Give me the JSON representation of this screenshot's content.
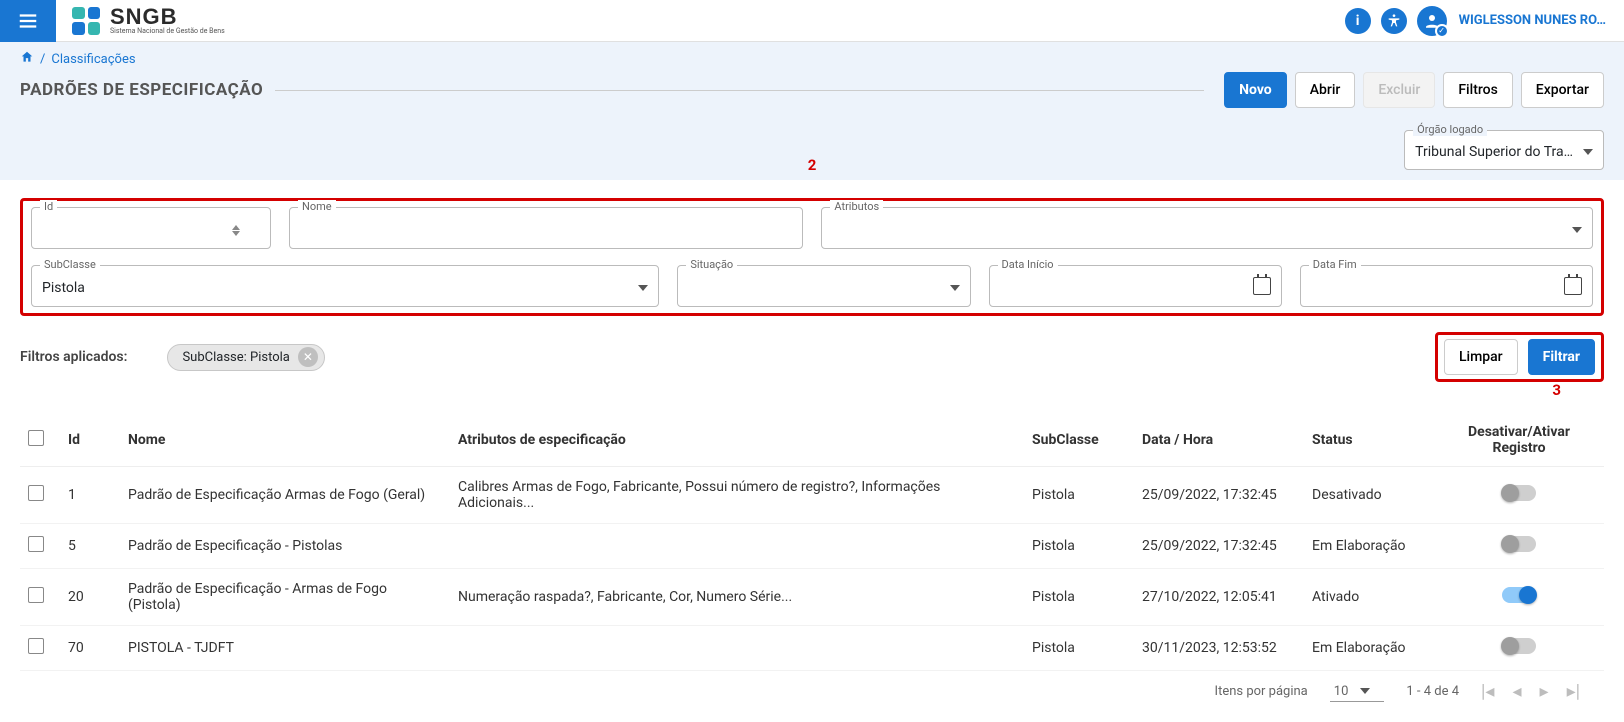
{
  "header": {
    "app_name": "SNGB",
    "app_subtitle": "Sistema Nacional de Gestão de Bens",
    "username": "WIGLESSON NUNES RO…"
  },
  "breadcrumb": {
    "item": "Classificações"
  },
  "page_title": "PADRÕES DE ESPECIFICAÇÃO",
  "actions": {
    "novo": "Novo",
    "abrir": "Abrir",
    "excluir": "Excluir",
    "filtros": "Filtros",
    "exportar": "Exportar"
  },
  "org": {
    "label": "Órgão logado",
    "value": "Tribunal Superior do Tra…"
  },
  "filters": {
    "id_label": "Id",
    "id_value": "",
    "nome_label": "Nome",
    "nome_value": "",
    "atributos_label": "Atributos",
    "atributos_value": "",
    "subclasse_label": "SubClasse",
    "subclasse_value": "Pistola",
    "situacao_label": "Situação",
    "situacao_value": "",
    "data_inicio_label": "Data Início",
    "data_inicio_value": "",
    "data_fim_label": "Data Fim",
    "data_fim_value": ""
  },
  "applied": {
    "label": "Filtros aplicados:",
    "chip": "SubClasse: Pistola"
  },
  "filter_actions": {
    "limpar": "Limpar",
    "filtrar": "Filtrar"
  },
  "annotations": {
    "two": "2",
    "three": "3"
  },
  "table": {
    "headers": {
      "id": "Id",
      "nome": "Nome",
      "atributos": "Atributos de especificação",
      "subclasse": "SubClasse",
      "datahora": "Data / Hora",
      "status": "Status",
      "toggle": "Desativar/Ativar Registro"
    },
    "rows": [
      {
        "id": "1",
        "nome": "Padrão de Especificação Armas de Fogo (Geral)",
        "atributos": "Calibres Armas de Fogo, Fabricante, Possui número de registro?, Informações Adicionais...",
        "subclasse": "Pistola",
        "datahora": "25/09/2022, 17:32:45",
        "status": "Desativado",
        "on": false
      },
      {
        "id": "5",
        "nome": "Padrão de Especificação - Pistolas",
        "atributos": "",
        "subclasse": "Pistola",
        "datahora": "25/09/2022, 17:32:45",
        "status": "Em Elaboração",
        "on": false
      },
      {
        "id": "20",
        "nome": "Padrão de Especificação - Armas de Fogo (Pistola)",
        "atributos": "Numeração raspada?, Fabricante, Cor, Numero Série...",
        "subclasse": "Pistola",
        "datahora": "27/10/2022, 12:05:41",
        "status": "Ativado",
        "on": true
      },
      {
        "id": "70",
        "nome": "PISTOLA - TJDFT",
        "atributos": "",
        "subclasse": "Pistola",
        "datahora": "30/11/2023, 12:53:52",
        "status": "Em Elaboração",
        "on": false
      }
    ]
  },
  "pagination": {
    "items_per_page_label": "Itens por página",
    "items_per_page_value": "10",
    "range": "1 - 4 de 4"
  }
}
